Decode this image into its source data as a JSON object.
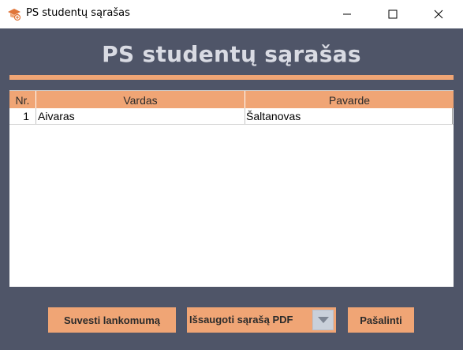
{
  "window": {
    "title": "PS studentų sąrašas"
  },
  "heading": "PS studentų sąrašas",
  "table": {
    "columns": [
      "Nr.",
      "Vardas",
      "Pavarde"
    ],
    "rows": [
      {
        "nr": "1",
        "vardas": "Aivaras",
        "pavarde": "Šaltanovas"
      }
    ]
  },
  "buttons": {
    "attendance": "Suvesti lankomumą",
    "save_pdf": "Išsaugoti sąrašą PDF",
    "delete": "Pašalinti"
  },
  "icons": {
    "app": "graduation-cap-icon",
    "minimize": "minimize-icon",
    "maximize": "maximize-icon",
    "close": "close-icon",
    "dropdown": "chevron-down-icon"
  },
  "colors": {
    "background": "#4f5568",
    "accent": "#f0a575",
    "heading": "#d9dbe3"
  }
}
